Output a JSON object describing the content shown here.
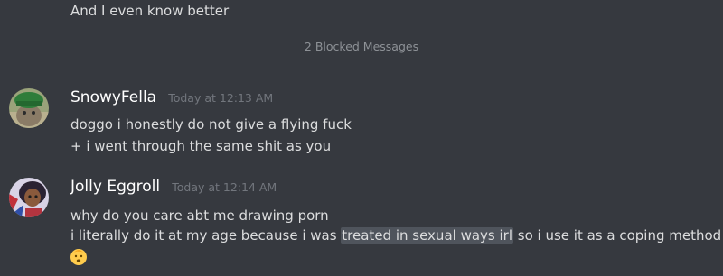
{
  "previous": {
    "text": "And I even know better"
  },
  "blocked": {
    "label": "2 Blocked Messages"
  },
  "messages": [
    {
      "username": "SnowyFella",
      "timestamp": "Today at 12:13 AM",
      "lines": [
        "doggo i honestly do not give a flying fuck",
        "+ i went through the same shit as you"
      ],
      "avatar_icon": "avatar-green-hat"
    },
    {
      "username": "Jolly Eggroll",
      "timestamp": "Today at 12:14 AM",
      "line1": "why do you care abt me drawing porn",
      "line2_before": "i literally do it at my age because i was ",
      "line2_highlight": "treated in sexual ways irl",
      "line2_after": " so i use it as a coping method",
      "emoji": "baby-face-emoji",
      "avatar_icon": "avatar-character"
    }
  ],
  "colors": {
    "background": "#36393f",
    "text": "#dcddde",
    "username": "#ffffff",
    "timestamp": "#72767d",
    "highlight": "#4f545c"
  }
}
